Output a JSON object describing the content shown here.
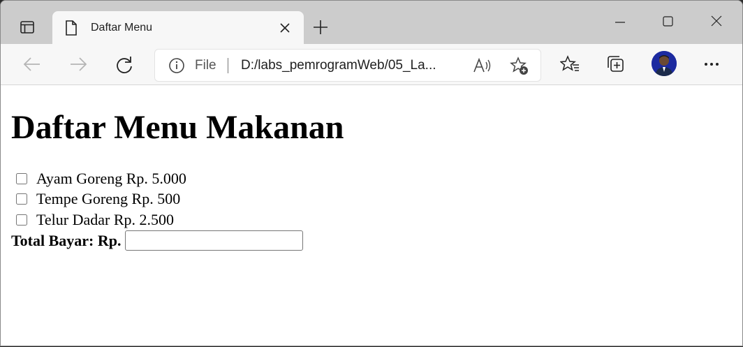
{
  "tab": {
    "title": "Daftar Menu"
  },
  "address": {
    "scheme_label": "File",
    "url": "D:/labs_pemrogramWeb/05_La..."
  },
  "page": {
    "heading": "Daftar Menu Makanan",
    "items": [
      {
        "label": "Ayam Goreng Rp. 5.000",
        "checked": false
      },
      {
        "label": "Tempe Goreng Rp. 500",
        "checked": false
      },
      {
        "label": "Telur Dadar Rp. 2.500",
        "checked": false
      }
    ],
    "total_label": "Total Bayar: Rp.",
    "total_value": ""
  },
  "colors": {
    "tabstrip": "#cccccc",
    "toolbar": "#f7f7f7",
    "avatar": "#1c2aa0"
  }
}
